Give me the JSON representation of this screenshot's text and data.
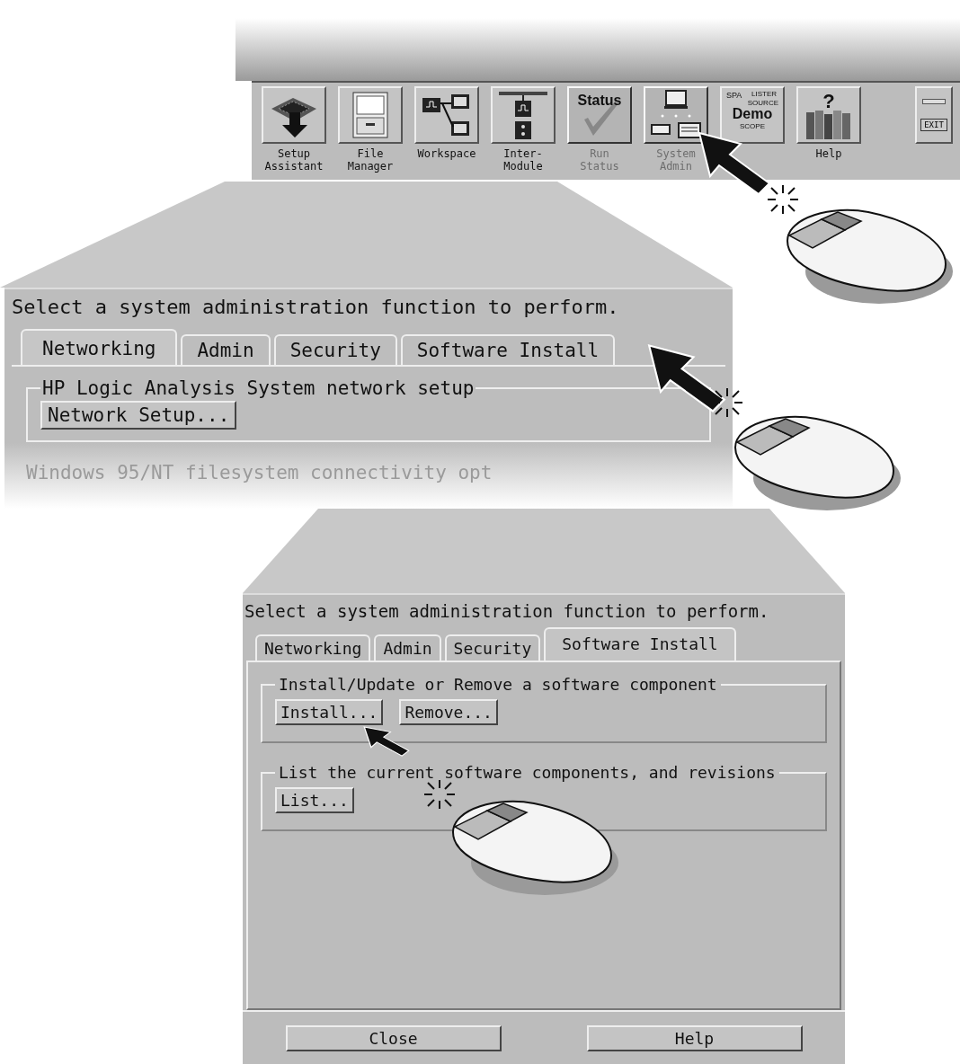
{
  "toolbar": {
    "buttons": [
      {
        "kind": "setup",
        "label_lines": [
          "Setup",
          "Assistant"
        ],
        "disabled": false
      },
      {
        "kind": "files",
        "label_lines": [
          "File",
          "Manager"
        ],
        "disabled": false
      },
      {
        "kind": "workspace",
        "label_lines": [
          "Workspace"
        ],
        "disabled": false
      },
      {
        "kind": "intermodule",
        "label_lines": [
          "Inter-",
          "Module"
        ],
        "disabled": false
      },
      {
        "kind": "status",
        "icon_text": [
          "Status"
        ],
        "label_lines": [
          "Run",
          "Status"
        ],
        "disabled": true
      },
      {
        "kind": "sysadmin",
        "label_lines": [
          "System",
          "Admin"
        ],
        "disabled": true
      },
      {
        "kind": "demo",
        "icon_text": [
          "SPA",
          "LISTER",
          "SOURCE",
          "Demo",
          "SCOPE"
        ],
        "disabled": false
      },
      {
        "kind": "help",
        "icon_text": [
          "?"
        ],
        "label_lines": [
          "Help"
        ],
        "disabled": false
      }
    ],
    "exit_button": {
      "label": "EXIT"
    }
  },
  "overview_panel": {
    "prompt": "Select a system administration function to perform.",
    "tabs": [
      {
        "label": "Networking",
        "selected": true
      },
      {
        "label": "Admin",
        "selected": false
      },
      {
        "label": "Security",
        "selected": false
      },
      {
        "label": "Software Install",
        "selected": false
      }
    ],
    "group": {
      "title": "HP Logic Analysis System network setup",
      "buttons": [
        "Network Setup..."
      ]
    },
    "faded_group": {
      "title": "Windows 95/NT filesystem connectivity opt"
    }
  },
  "detail_panel": {
    "prompt": "Select a system administration function to perform.",
    "tabs": [
      {
        "label": "Networking",
        "selected": false
      },
      {
        "label": "Admin",
        "selected": false
      },
      {
        "label": "Security",
        "selected": false
      },
      {
        "label": "Software Install",
        "selected": true
      }
    ],
    "groups": [
      {
        "title": "Install/Update or Remove a software component",
        "buttons": [
          "Install...",
          "Remove..."
        ]
      },
      {
        "title": "List the current software components, and revisions",
        "buttons": [
          "List..."
        ]
      }
    ],
    "footer_buttons": [
      "Close",
      "Help"
    ]
  }
}
